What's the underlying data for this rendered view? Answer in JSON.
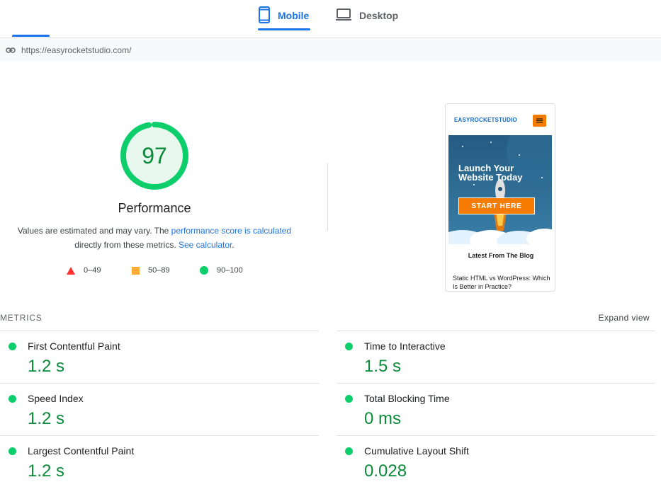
{
  "tabs": [
    {
      "label": "Mobile",
      "icon": "smartphone-icon",
      "active": true
    },
    {
      "label": "Desktop",
      "icon": "laptop-icon",
      "active": false
    }
  ],
  "url": "https://easyrocketstudio.com/",
  "performance": {
    "score": "97",
    "score_value": 97,
    "title": "Performance",
    "desc_part1": "Values are estimated and may vary. The ",
    "desc_link1": "performance score is calculated",
    "desc_part2": "directly from these metrics. ",
    "desc_link2": "See calculator",
    "desc_end": "."
  },
  "legend": [
    {
      "label": "0–49",
      "shape": "triangle",
      "color": "#ff3333"
    },
    {
      "label": "50–89",
      "shape": "square",
      "color": "#ffaa33"
    },
    {
      "label": "90–100",
      "shape": "circle",
      "color": "#0cce6b"
    }
  ],
  "preview": {
    "logo": "EASYROCKETSTUDIO",
    "hero_title": "Launch Your Website Today",
    "hero_button": "START HERE",
    "blog_heading": "Latest From The Blog",
    "blog_item": "Static HTML vs WordPress: Which Is Better in Practice?"
  },
  "metrics_section": {
    "header": "METRICS",
    "expand": "Expand view"
  },
  "metrics": [
    {
      "label": "First Contentful Paint",
      "value": "1.2 s"
    },
    {
      "label": "Time to Interactive",
      "value": "1.5 s"
    },
    {
      "label": "Speed Index",
      "value": "1.2 s"
    },
    {
      "label": "Total Blocking Time",
      "value": "0 ms"
    },
    {
      "label": "Largest Contentful Paint",
      "value": "1.2 s"
    },
    {
      "label": "Cumulative Layout Shift",
      "value": "0.028"
    }
  ],
  "colors": {
    "accent": "#1a73e8",
    "pass": "#0cce6b",
    "pass_text": "#0b8a3a",
    "average": "#ffaa33",
    "fail": "#ff3333"
  }
}
